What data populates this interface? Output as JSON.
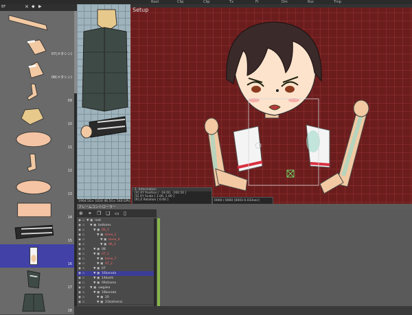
{
  "topbar": {
    "items": [
      "Root",
      "Clip",
      "Clip",
      "Tx",
      "Fr",
      "Dm",
      "Rsz",
      "Tmp"
    ]
  },
  "parts_panel": {
    "toolbar_label": "BF",
    "items": [
      {
        "num": "",
        "label": ""
      },
      {
        "num": "07(メタシン)",
        "label": ""
      },
      {
        "num": "08(メタシン)",
        "label": ""
      },
      {
        "num": "09",
        "label": ""
      },
      {
        "num": "10",
        "label": ""
      },
      {
        "num": "11",
        "label": ""
      },
      {
        "num": "12",
        "label": ""
      },
      {
        "num": "13",
        "label": ""
      },
      {
        "num": "14",
        "label": ""
      },
      {
        "num": "15",
        "label": ""
      },
      {
        "num": "16",
        "label": ""
      },
      {
        "num": "17",
        "label": ""
      },
      {
        "num": "18",
        "label": ""
      }
    ],
    "selected_index": 10
  },
  "texture_panel": {
    "status": "1904.5G× 1024 46.5G× 540 GPU Range  |  46.2Pc"
  },
  "canvas": {
    "title": "Setup",
    "bg_color": "#6b1d1d"
  },
  "info": {
    "position": "[X] XY Position  [ -18.00, -160.50 ]",
    "scale": "[S] XY Scale  [ 1.00, 1.00 ]",
    "rotation": "[R] Z Rotation  [ 0.00 ]",
    "header": "1. Information",
    "frame": "0000 / 0000 [0001:0.033sec]"
  },
  "timeline": {
    "title": "フレームコントローラー",
    "rows": [
      {
        "indent": 0,
        "label": "root",
        "red": false
      },
      {
        "indent": 1,
        "label": "bottoms",
        "red": false
      },
      {
        "indent": 2,
        "label": "06_1",
        "red": true
      },
      {
        "indent": 3,
        "label": "bone_1",
        "red": true
      },
      {
        "indent": 4,
        "label": "bone_4",
        "red": true
      },
      {
        "indent": 4,
        "label": "06_2",
        "red": true
      },
      {
        "indent": 2,
        "label": "08",
        "red": false
      },
      {
        "indent": 2,
        "label": "07_1",
        "red": true
      },
      {
        "indent": 3,
        "label": "bone_7",
        "red": true
      },
      {
        "indent": 3,
        "label": "07_2",
        "red": true
      },
      {
        "indent": 2,
        "label": "07",
        "red": false
      },
      {
        "indent": 2,
        "label": "16karada",
        "red": false,
        "selected": true
      },
      {
        "indent": 2,
        "label": "14koshi",
        "red": false
      },
      {
        "indent": 2,
        "label": "09sitama",
        "red": false
      },
      {
        "indent": 1,
        "label": "uwgaka",
        "red": false
      },
      {
        "indent": 2,
        "label": "18karada",
        "red": false
      },
      {
        "indent": 3,
        "label": "20",
        "red": false
      },
      {
        "indent": 3,
        "label": "21kaiheirai",
        "red": false
      }
    ]
  },
  "colors": {
    "accent": "#4141a8",
    "keyframe": "#87b54a",
    "canvas": "#6b1d1d"
  }
}
